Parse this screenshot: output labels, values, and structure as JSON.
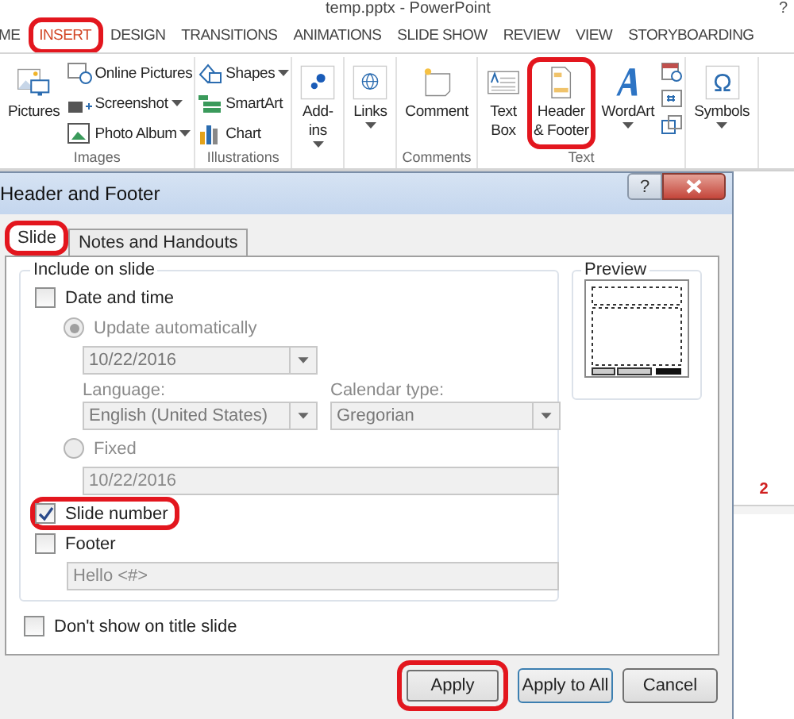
{
  "window": {
    "title": "temp.pptx - PowerPoint",
    "help": "?"
  },
  "ribbon_tabs": [
    {
      "label": "ME",
      "selected": false,
      "highlighted": false
    },
    {
      "label": "INSERT",
      "selected": true,
      "highlighted": true
    },
    {
      "label": "DESIGN",
      "selected": false,
      "highlighted": false
    },
    {
      "label": "TRANSITIONS",
      "selected": false,
      "highlighted": false
    },
    {
      "label": "ANIMATIONS",
      "selected": false,
      "highlighted": false
    },
    {
      "label": "SLIDE SHOW",
      "selected": false,
      "highlighted": false
    },
    {
      "label": "REVIEW",
      "selected": false,
      "highlighted": false
    },
    {
      "label": "VIEW",
      "selected": false,
      "highlighted": false
    },
    {
      "label": "STORYBOARDING",
      "selected": false,
      "highlighted": false
    }
  ],
  "ribbon_groups": [
    {
      "label": "Images",
      "items": [
        {
          "kind": "large",
          "lines": [
            "Pictures"
          ],
          "dropdown": false,
          "highlighted": false
        },
        {
          "kind": "stack",
          "entries": [
            {
              "label": "Online Pictures",
              "dropdown": false
            },
            {
              "label": "Screenshot",
              "dropdown": true
            },
            {
              "label": "Photo Album",
              "dropdown": true
            }
          ]
        }
      ]
    },
    {
      "label": "Illustrations",
      "items": [
        {
          "kind": "stack",
          "entries": [
            {
              "label": "Shapes",
              "dropdown": true
            },
            {
              "label": "SmartArt",
              "dropdown": false
            },
            {
              "label": "Chart",
              "dropdown": false
            }
          ]
        }
      ]
    },
    {
      "items": [
        {
          "kind": "large",
          "lines": [
            "Add-",
            "ins"
          ],
          "dropdown": true,
          "highlighted": false
        }
      ]
    },
    {
      "items": [
        {
          "kind": "large",
          "lines": [
            "Links"
          ],
          "dropdown": true,
          "highlighted": false
        }
      ]
    },
    {
      "label": "Comments",
      "items": [
        {
          "kind": "large",
          "lines": [
            "Comment"
          ],
          "dropdown": false,
          "highlighted": false
        }
      ]
    },
    {
      "label": "Text",
      "items": [
        {
          "kind": "large",
          "lines": [
            "Text",
            "Box"
          ],
          "dropdown": false,
          "highlighted": false
        },
        {
          "kind": "large",
          "lines": [
            "Header",
            "& Footer"
          ],
          "dropdown": false,
          "highlighted": true
        },
        {
          "kind": "large",
          "lines": [
            "WordArt"
          ],
          "dropdown": true,
          "highlighted": false
        },
        {
          "kind": "icons"
        }
      ]
    },
    {
      "items": [
        {
          "kind": "large",
          "lines": [
            "Symbols"
          ],
          "dropdown": true,
          "highlighted": false
        }
      ]
    }
  ],
  "dialog": {
    "title": "Header and Footer",
    "help": "?",
    "tabs": [
      {
        "label": "Slide",
        "selected": true,
        "highlighted": true
      },
      {
        "label": "Notes and Handouts",
        "selected": false,
        "highlighted": false
      }
    ],
    "group_title": "Include on slide",
    "date_time": {
      "label": "Date and time",
      "checked": false
    },
    "update_auto": {
      "label": "Update automatically",
      "selected": true
    },
    "date_value": "10/22/2016",
    "language_label": "Language:",
    "language_value": "English (United States)",
    "calendar_label": "Calendar type:",
    "calendar_value": "Gregorian",
    "fixed": {
      "label": "Fixed",
      "selected": false
    },
    "fixed_value": "10/22/2016",
    "slide_number": {
      "label": "Slide number",
      "checked": true,
      "highlighted": true
    },
    "footer": {
      "label": "Footer",
      "checked": false
    },
    "footer_value": "Hello <#>",
    "dont_show": {
      "label": "Don't show on title slide",
      "checked": false
    },
    "preview_title": "Preview",
    "buttons": [
      {
        "label": "Apply",
        "default": false,
        "highlighted": true
      },
      {
        "label": "Apply to All",
        "default": true,
        "highlighted": false
      },
      {
        "label": "Cancel",
        "default": false,
        "highlighted": false
      }
    ]
  },
  "slide": {
    "number": "2"
  }
}
